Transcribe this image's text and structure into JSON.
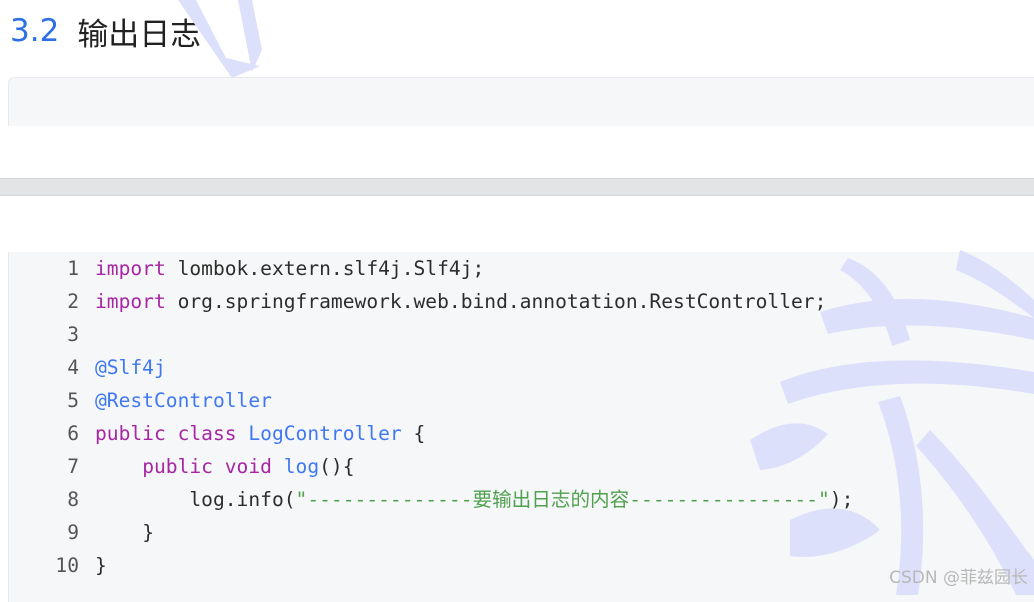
{
  "heading": {
    "number": "3.2",
    "title": "输出日志"
  },
  "code": {
    "lines": [
      {
        "n": "1",
        "import_kw": "import",
        "rest": " lombok.extern.slf4j.Slf4j;"
      },
      {
        "n": "2",
        "import_kw": "import",
        "rest": " org.springframework.web.bind.annotation.RestController;"
      },
      {
        "n": "3"
      },
      {
        "n": "4",
        "annotation": "@Slf4j"
      },
      {
        "n": "5",
        "annotation": "@RestController"
      },
      {
        "n": "6",
        "kw1": "public",
        "kw2": "class",
        "name": "LogController",
        "rest": " {"
      },
      {
        "n": "7",
        "indent": "    ",
        "kw1": "public",
        "kw2": "void",
        "name": "log",
        "rest": "(){"
      },
      {
        "n": "8",
        "indent": "        ",
        "pre": "log.info(",
        "str": "\"--------------要输出日志的内容----------------\"",
        "post": ");"
      },
      {
        "n": "9",
        "indent": "    ",
        "rest": "}"
      },
      {
        "n": "10",
        "rest": "}"
      }
    ]
  },
  "watermark_text": "CSDN @菲兹园长",
  "colors": {
    "heading_number": "#2f6fe6",
    "keyword": "#a626a4",
    "function": "#4078f2",
    "string": "#50a14f",
    "watermark_shape": "#dde0fb"
  }
}
